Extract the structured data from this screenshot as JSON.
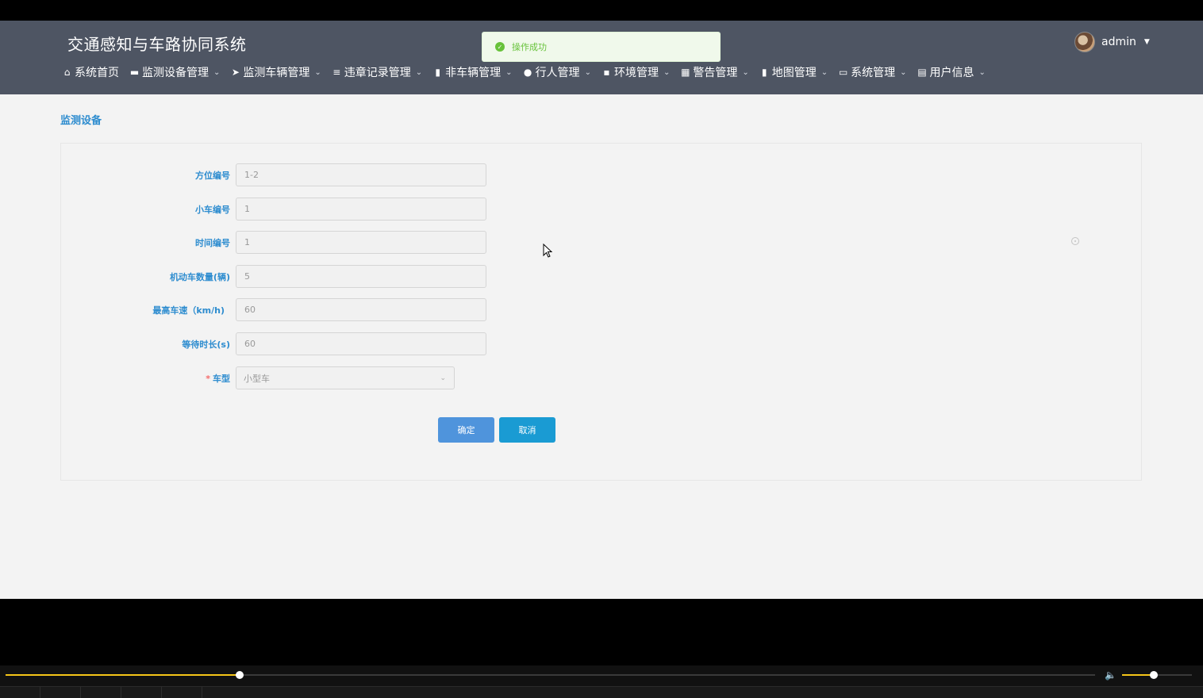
{
  "app": {
    "title": "交通感知与车路协同系统"
  },
  "user": {
    "name": "admin"
  },
  "toast": {
    "message": "操作成功"
  },
  "nav": [
    {
      "label": "系统首页",
      "icon": "home-icon",
      "glyph": "⌂",
      "dropdown": false
    },
    {
      "label": "监测设备管理",
      "icon": "briefcase-icon",
      "glyph": "▬",
      "dropdown": true
    },
    {
      "label": "监测车辆管理",
      "icon": "send-icon",
      "glyph": "➤",
      "dropdown": true
    },
    {
      "label": "违章记录管理",
      "icon": "sliders-icon",
      "glyph": "≡",
      "dropdown": true
    },
    {
      "label": "非车辆管理",
      "icon": "book-icon",
      "glyph": "▮",
      "dropdown": true
    },
    {
      "label": "行人管理",
      "icon": "user-icon",
      "glyph": "●",
      "dropdown": true
    },
    {
      "label": "环境管理",
      "icon": "comment-icon",
      "glyph": "▪",
      "dropdown": true
    },
    {
      "label": "警告管理",
      "icon": "grid-icon",
      "glyph": "▦",
      "dropdown": true
    },
    {
      "label": "地图管理",
      "icon": "clipboard-icon",
      "glyph": "▮",
      "dropdown": true
    },
    {
      "label": "系统管理",
      "icon": "monitor-icon",
      "glyph": "▭",
      "dropdown": true
    },
    {
      "label": "用户信息",
      "icon": "card-icon",
      "glyph": "▤",
      "dropdown": true
    }
  ],
  "page": {
    "section_title": "监测设备"
  },
  "form": {
    "fields": [
      {
        "label": "方位编号",
        "value": "1-2",
        "required": false
      },
      {
        "label": "小车编号",
        "value": "1",
        "required": false
      },
      {
        "label": "时间编号",
        "value": "1",
        "required": false
      },
      {
        "label": "机动车数量(辆)",
        "value": "5",
        "required": false
      },
      {
        "label": "最高车速（km/h)",
        "value": "60",
        "required": false
      },
      {
        "label": "等待时长(s)",
        "value": "60",
        "required": false
      }
    ],
    "vehicle_type": {
      "label": "车型",
      "required_mark": "*",
      "value": "小型车"
    },
    "ok_label": "确定",
    "cancel_label": "取消"
  },
  "player": {
    "progress": 0.215,
    "volume": 0.45
  },
  "colors": {
    "header": "#4e5563",
    "accent": "#2d8ccf",
    "ok": "#4f94dc",
    "cancel": "#1a9bd3",
    "progress": "#f5c518",
    "success": "#67c23a"
  }
}
